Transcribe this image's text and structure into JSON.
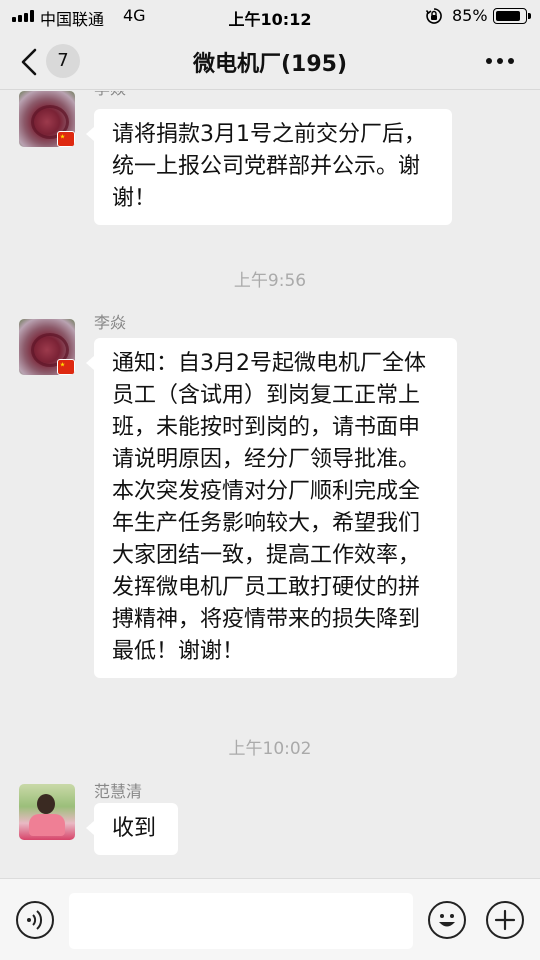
{
  "status_bar": {
    "carrier": "中国联通",
    "network": "4G",
    "time": "上午10:12",
    "battery_percent": "85%",
    "battery_level": 0.85,
    "icons": [
      "signal-icon",
      "orientation-lock-icon",
      "battery-icon"
    ]
  },
  "nav": {
    "back_icon": "chevron-left-icon",
    "unread_count": "7",
    "title": "微电机厂(195)",
    "more_icon": "ellipsis-icon"
  },
  "messages": [
    {
      "sender": "李焱",
      "text": "请将捐款3月1号之前交分厂后，统一上报公司党群部并公示。谢谢！"
    },
    {
      "sender": "李焱",
      "text": "通知：自3月2号起微电机厂全体员工（含试用）到岗复工正常上班，未能按时到岗的，请书面申请说明原因，经分厂领导批准。本次突发疫情对分厂顺利完成全年生产任务影响较大，希望我们大家团结一致，提高工作效率，发挥微电机厂员工敢打硬仗的拼搏精神，将疫情带来的损失降到最低！谢谢！"
    },
    {
      "sender": "范慧清",
      "text": "收到"
    }
  ],
  "timestamps": [
    "上午9:56",
    "上午10:02"
  ],
  "input_bar": {
    "voice_icon": "voice-icon",
    "text_value": "",
    "emoji_icon": "emoji-icon",
    "plus_icon": "plus-icon"
  }
}
